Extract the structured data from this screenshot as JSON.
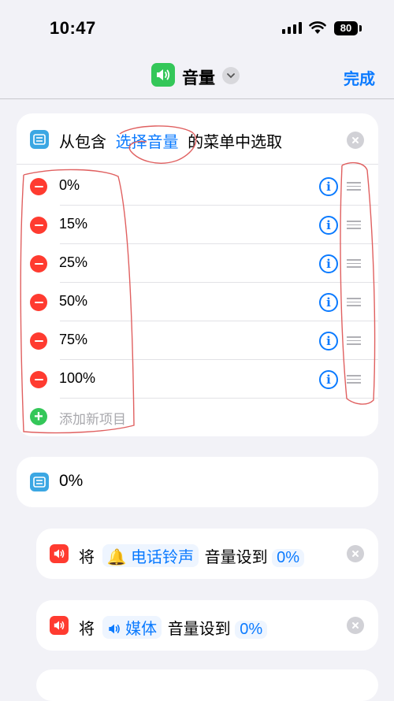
{
  "status_bar": {
    "time": "10:47",
    "battery": "80",
    "signal_icon": "cellular-signal-icon",
    "wifi_icon": "wifi-icon"
  },
  "nav": {
    "app_icon": "speaker-icon",
    "title": "音量",
    "done": "完成"
  },
  "choose_menu": {
    "prefix": "从包含",
    "token": "选择音量",
    "suffix": "的菜单中选取",
    "items": [
      "0%",
      "15%",
      "25%",
      "50%",
      "75%",
      "100%"
    ],
    "add_item": "添加新项目"
  },
  "result": {
    "value": "0%"
  },
  "set_volume_1": {
    "will": "将",
    "target": "电话铃声",
    "set_to": "音量设到",
    "value": "0%"
  },
  "set_volume_2": {
    "will": "将",
    "target": "媒体",
    "set_to": "音量设到",
    "value": "0%"
  },
  "colors": {
    "accent": "#0a7aff",
    "green": "#34c759",
    "red": "#ff3b30",
    "background": "#f2f2f7",
    "annotation": "#e06060"
  }
}
